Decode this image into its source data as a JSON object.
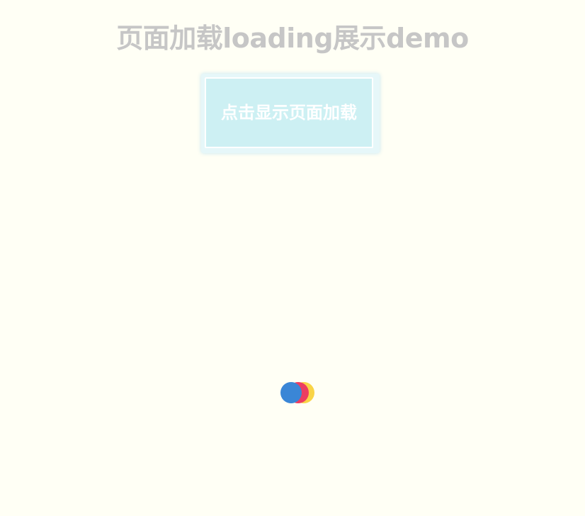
{
  "page": {
    "title": "页面加载loading展示demo"
  },
  "button": {
    "label": "点击显示页面加载"
  },
  "loader": {
    "dots": [
      {
        "name": "yellow",
        "color": "#f9d447"
      },
      {
        "name": "red",
        "color": "#ec3d61"
      },
      {
        "name": "blue",
        "color": "#3a86d6"
      }
    ]
  }
}
